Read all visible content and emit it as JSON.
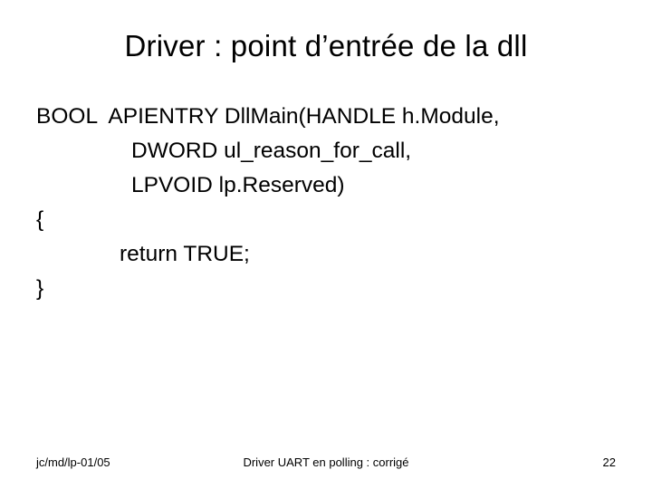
{
  "title": "Driver : point d’entrée de la dll",
  "code": {
    "l1": "BOOL  APIENTRY DllMain(HANDLE h.Module,",
    "l2": "DWORD ul_reason_for_call,",
    "l3": "LPVOID lp.Reserved)",
    "l4": "{",
    "l5": "return TRUE;",
    "l6": "}"
  },
  "footer": {
    "left": "jc/md/lp-01/05",
    "center": "Driver UART en polling : corrigé",
    "page": "22"
  }
}
